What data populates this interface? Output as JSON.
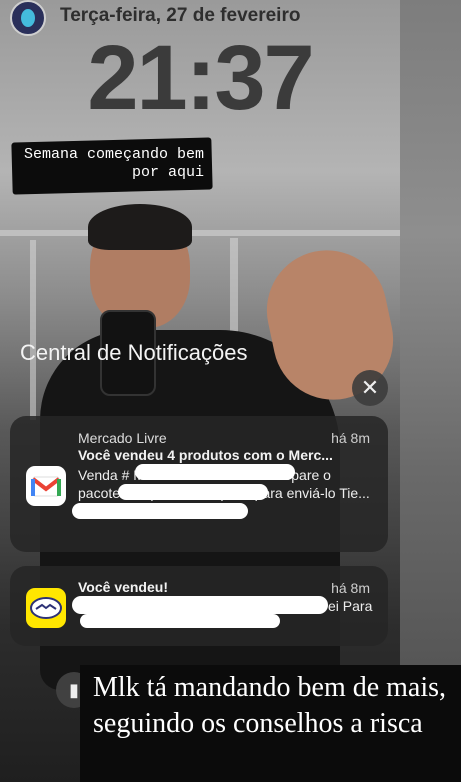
{
  "story": {
    "date": "Terça-feira, 27 de fevereiro",
    "time": "21:37",
    "caption_top": "Semana começando bem por aqui",
    "caption_bottom": "Mlk tá mandando bem de mais, seguindo os conselhos a risca"
  },
  "notification_center": {
    "title": "Central de Notificações",
    "clear_icon": "close-icon"
  },
  "notifications": [
    {
      "app": "Mercado Livre",
      "icon": "gmail-icon",
      "time": "há 8m",
      "title": "Você vendeu 4 produtos com o Merc...",
      "body": "Venda # Mercado Livre Venda Prepare o pacote e imprima a etiqueta para enviá-lo Tie..."
    },
    {
      "app": "",
      "icon": "mercado-livre-icon",
      "time": "há 8m",
      "title": "Você vendeu!",
      "body": "ei Para"
    }
  ],
  "colors": {
    "notif_bg": "#262626",
    "ml_yellow": "#ffe600",
    "gmail_red": "#ea4335"
  }
}
